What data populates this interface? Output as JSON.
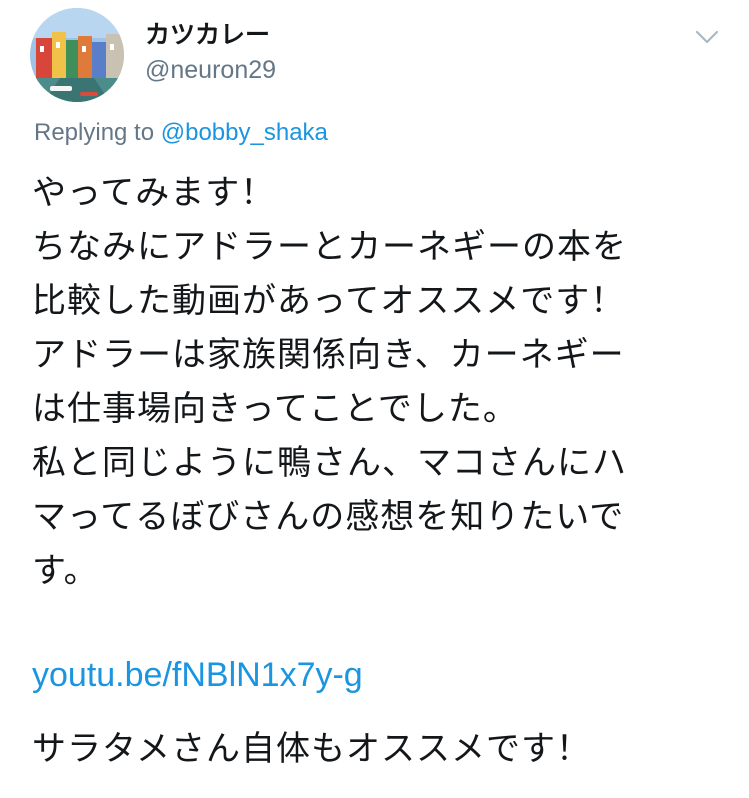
{
  "author": {
    "display_name": "カツカレー",
    "handle": "@neuron29"
  },
  "reply": {
    "prefix": "Replying to ",
    "mention": "@bobby_shaka"
  },
  "tweet": {
    "lines": [
      "やってみます！",
      "ちなみにアドラーとカーネギーの本を",
      "比較した動画があってオススメです！",
      "アドラーは家族関係向き、カーネギー",
      "は仕事場向きってことでした。",
      "私と同じように鴨さん、マコさんにハ",
      "マってるぼびさんの感想を知りたいで",
      "す。"
    ],
    "link": "youtu.be/fNBlN1x7y-g",
    "last_line": "サラタメさん自体もオススメです！"
  },
  "icons": {
    "avatar": "avatar-photo-canal-houses",
    "menu": "chevron-down-icon"
  },
  "colors": {
    "link": "#1b95e0",
    "secondary": "#657786",
    "text": "#14171a"
  }
}
